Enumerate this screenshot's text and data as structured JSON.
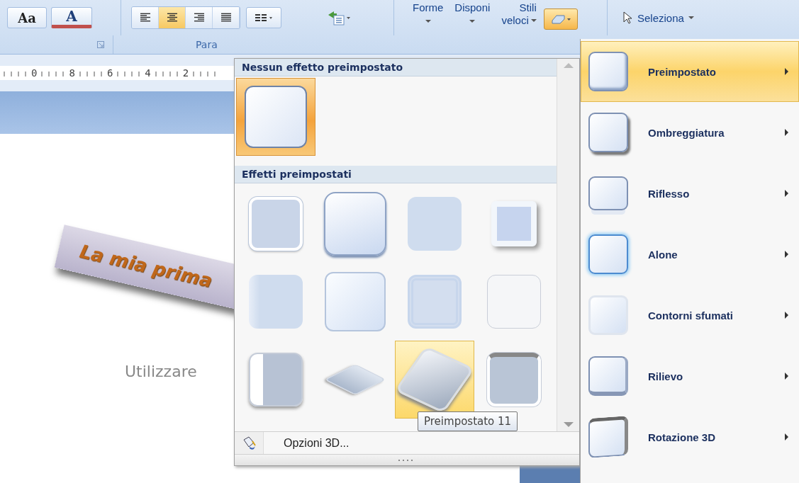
{
  "ribbon": {
    "font_buttons": [
      {
        "kind": "font-size",
        "label": "Aa"
      },
      {
        "kind": "font-color",
        "label": "A"
      }
    ],
    "paragraph_label": "Para",
    "align_buttons": [
      {
        "kind": "left",
        "selected": false
      },
      {
        "kind": "center",
        "selected": true
      },
      {
        "kind": "right",
        "selected": false
      },
      {
        "kind": "justify",
        "selected": false
      }
    ],
    "drawing_buttons": [
      {
        "label": "Forme"
      },
      {
        "label": "Disponi"
      }
    ],
    "quick_styles": {
      "lines": [
        "Stili",
        "veloci"
      ]
    },
    "shape_effects_button": {
      "expanded": true
    },
    "select_button": {
      "label": "Seleziona"
    }
  },
  "ruler": {
    "labels": [
      "0",
      "8",
      "6",
      "4",
      "2"
    ]
  },
  "slide": {
    "title": "La mia prima",
    "subtitle": "Utilizzare"
  },
  "gallery": {
    "sections": [
      {
        "title": "Nessun effetto preimpostato",
        "items": [
          {
            "kind": "none",
            "selected": true,
            "hovered": false
          }
        ]
      },
      {
        "title": "Effetti preimpostati",
        "items": [
          {
            "kind": "flat-frame",
            "selected": false,
            "hovered": false
          },
          {
            "kind": "raised",
            "selected": false,
            "hovered": false
          },
          {
            "kind": "soft-corner",
            "selected": false,
            "hovered": false
          },
          {
            "kind": "bevel-inset",
            "selected": false,
            "hovered": false
          },
          {
            "kind": "soft-left",
            "selected": false,
            "hovered": false
          },
          {
            "kind": "soft-bevel",
            "selected": false,
            "hovered": false
          },
          {
            "kind": "double-frame",
            "selected": false,
            "hovered": false
          },
          {
            "kind": "faint",
            "selected": false,
            "hovered": false
          },
          {
            "kind": "box-left",
            "selected": false,
            "hovered": false
          },
          {
            "kind": "tilted",
            "selected": false,
            "hovered": false
          },
          {
            "kind": "angled",
            "selected": false,
            "hovered": true
          },
          {
            "kind": "box-top",
            "selected": false,
            "hovered": false
          }
        ]
      }
    ],
    "tooltip": "Preimpostato 11",
    "footer": {
      "label": "Opzioni 3D..."
    }
  },
  "submenu": {
    "items": [
      {
        "kind": "preset",
        "label": "Preimpostato",
        "selected": true
      },
      {
        "kind": "shadow",
        "label": "Ombreggiatura",
        "selected": false
      },
      {
        "kind": "reflection",
        "label": "Riflesso",
        "selected": false
      },
      {
        "kind": "glow",
        "label": "Alone",
        "selected": false
      },
      {
        "kind": "soft-edges",
        "label": "Contorni sfumati",
        "selected": false
      },
      {
        "kind": "bevel",
        "label": "Rilievo",
        "selected": false
      },
      {
        "kind": "rotation",
        "label": "Rotazione 3D",
        "selected": false
      }
    ]
  }
}
